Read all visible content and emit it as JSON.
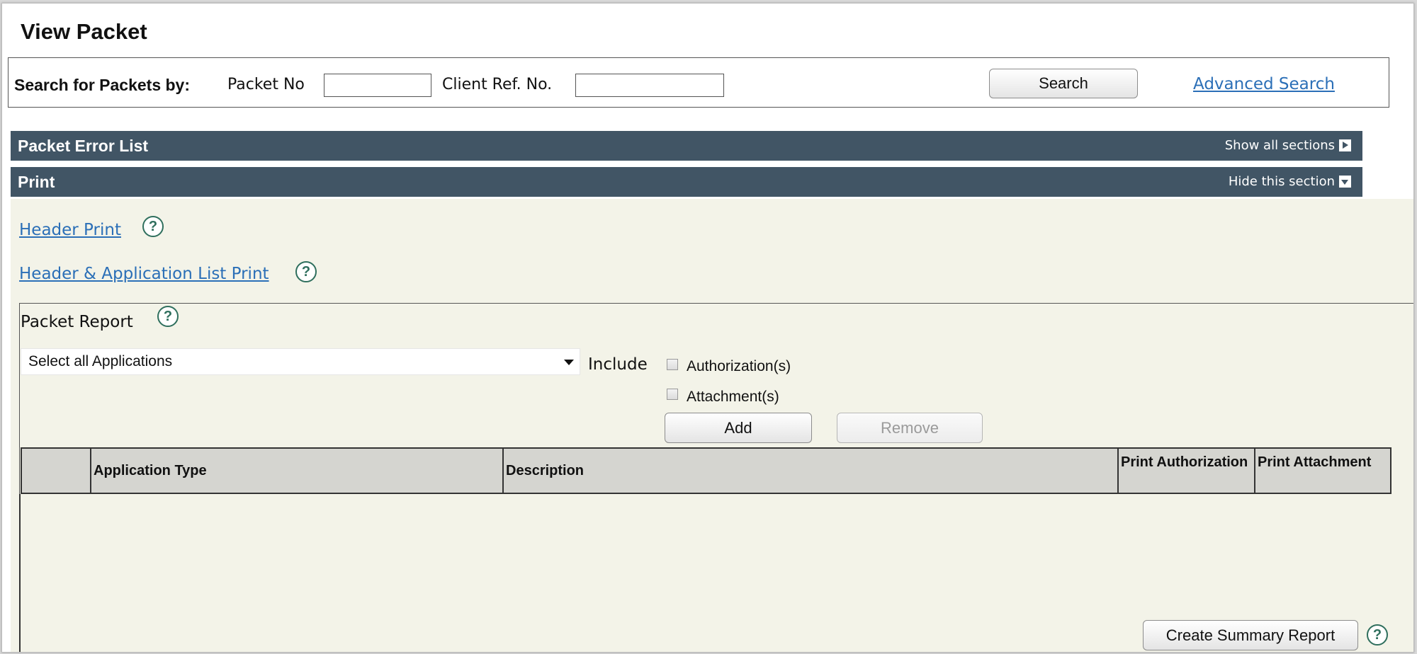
{
  "page": {
    "title": "View Packet"
  },
  "search": {
    "label": "Search for Packets by:",
    "packet_no_label": "Packet No",
    "packet_no_value": "",
    "client_ref_label": "Client Ref. No.",
    "client_ref_value": "",
    "search_button": "Search",
    "advanced_link": "Advanced Search"
  },
  "sections": {
    "error_list": {
      "title": "Packet Error List",
      "toggle": "Show all sections"
    },
    "print": {
      "title": "Print",
      "toggle": "Hide this section"
    }
  },
  "print": {
    "header_print": "Header Print",
    "header_app_list_print": "Header & Application List Print",
    "help_glyph": "?",
    "report": {
      "title": "Packet Report",
      "select_value": "Select all Applications",
      "include_label": "Include",
      "options": [
        {
          "label": "Authorization(s)",
          "checked": false
        },
        {
          "label": "Attachment(s)",
          "checked": false
        }
      ],
      "add_button": "Add",
      "remove_button": "Remove",
      "table_headers": [
        "",
        "Application Type",
        "Description",
        "Print Authorization",
        "Print Attachment"
      ],
      "rows": [],
      "create_summary_button": "Create Summary Report"
    }
  },
  "colors": {
    "section_bar": "#415565",
    "panel_bg": "#f3f3e8",
    "link": "#2b6fb7",
    "help_icon": "#2f6f5d"
  },
  "icons": {
    "show_all": "triangle-right-icon",
    "hide_section": "triangle-down-icon",
    "help": "help-circle-icon",
    "dropdown": "chevron-down-icon"
  }
}
